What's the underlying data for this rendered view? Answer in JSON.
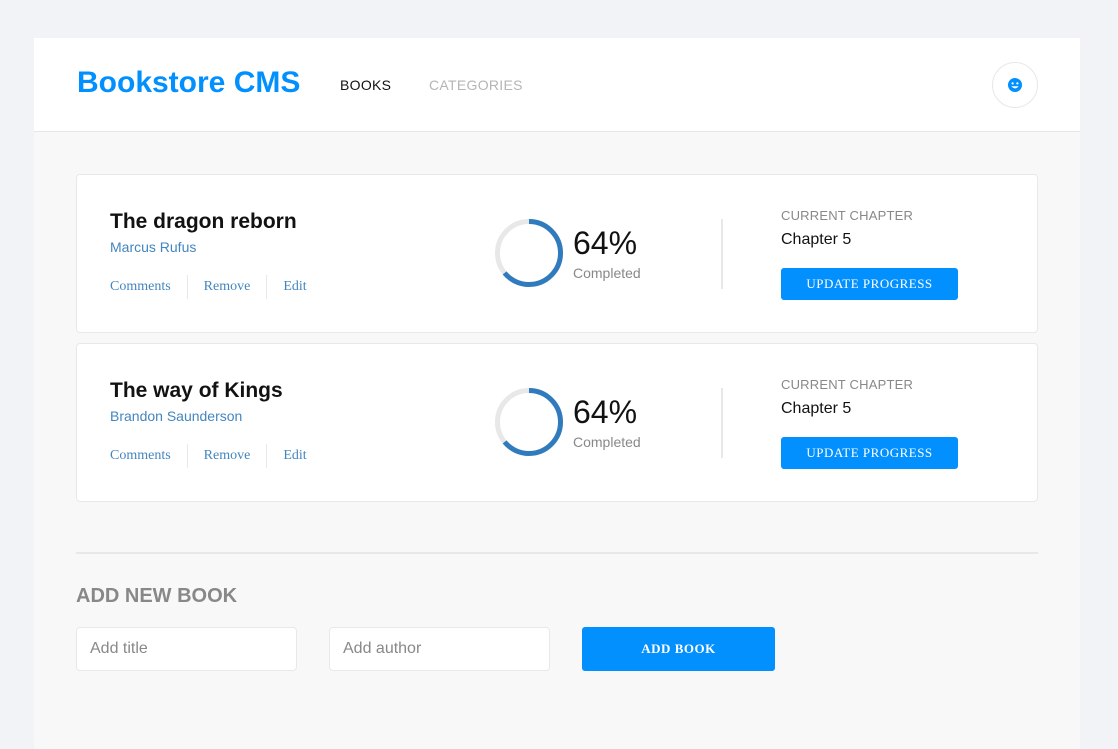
{
  "header": {
    "brand": "Bookstore CMS",
    "nav": [
      {
        "label": "BOOKS",
        "active": true
      },
      {
        "label": "CATEGORIES",
        "active": false
      }
    ],
    "user_icon": "user-icon"
  },
  "books": [
    {
      "title": "The dragon reborn",
      "author": "Marcus Rufus",
      "actions": [
        "Comments",
        "Remove",
        "Edit"
      ],
      "progress_percent": 64,
      "percent_label": "64%",
      "completed_label": "Completed",
      "chapter_label": "CURRENT CHAPTER",
      "chapter": "Chapter 5",
      "update_label": "UPDATE PROGRESS"
    },
    {
      "title": "The way of Kings",
      "author": "Brandon Saunderson",
      "actions": [
        "Comments",
        "Remove",
        "Edit"
      ],
      "progress_percent": 64,
      "percent_label": "64%",
      "completed_label": "Completed",
      "chapter_label": "CURRENT CHAPTER",
      "chapter": "Chapter 5",
      "update_label": "UPDATE PROGRESS"
    }
  ],
  "add_book": {
    "heading": "ADD NEW BOOK",
    "title_placeholder": "Add title",
    "author_placeholder": "Add author",
    "button_label": "ADD BOOK"
  },
  "colors": {
    "accent": "#0290ff",
    "link": "#4386bf",
    "progress": "#307bbe",
    "progress_track": "#e8e8e8"
  }
}
